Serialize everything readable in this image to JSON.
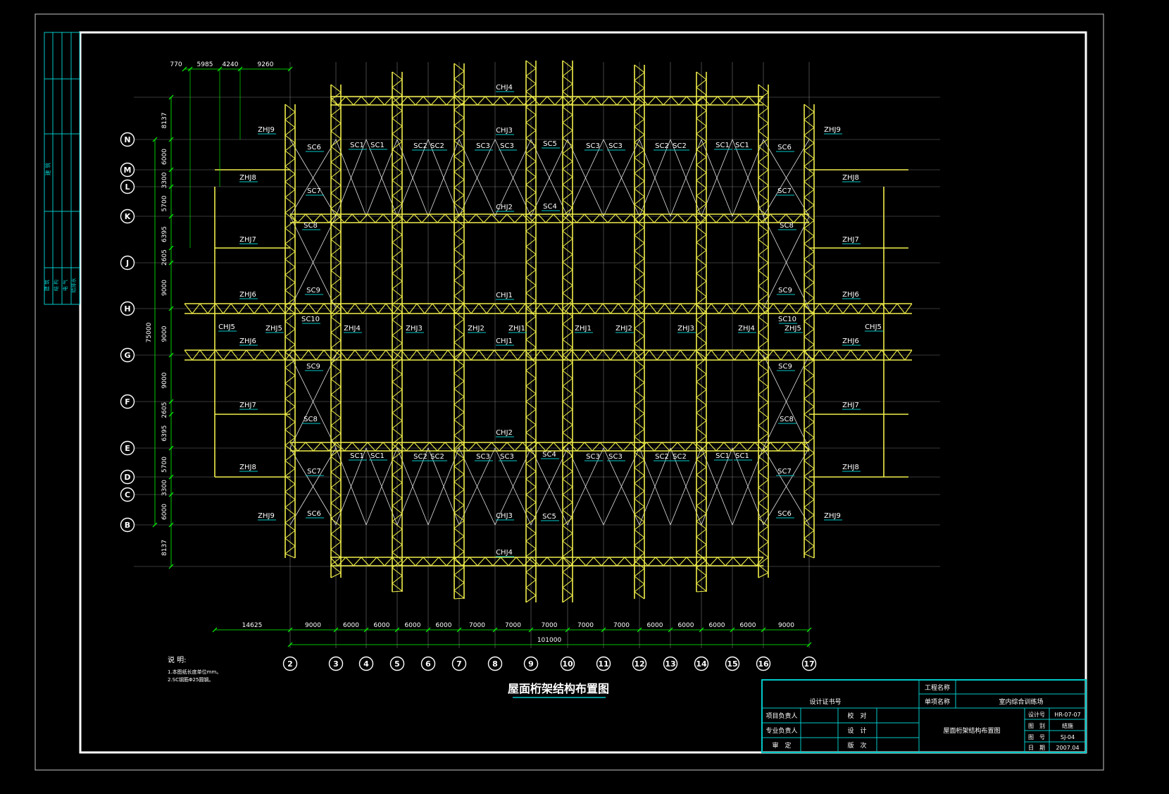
{
  "drawing": {
    "title": "屋面桁架结构布置图",
    "notes": {
      "heading": "说 明:",
      "lines": [
        "1.本图纸长度单位mm。",
        "2.SC钢筋Φ25圆钢。"
      ]
    },
    "colors": {
      "background": "#000000",
      "frame": "#ffffff",
      "truss": "#f0ee4a",
      "grid": "#cfcfcf",
      "dim": "#ffffff",
      "text": "#ffffff",
      "label_underline": "#00c8c8",
      "title_block": "#00c8c8"
    }
  },
  "axes": {
    "row_labels": [
      "N",
      "M",
      "L",
      "K",
      "J",
      "H",
      "G",
      "F",
      "E",
      "D",
      "C",
      "B"
    ],
    "col_labels": [
      "2",
      "3",
      "4",
      "5",
      "6",
      "7",
      "8",
      "9",
      "10",
      "11",
      "12",
      "13",
      "14",
      "15",
      "16",
      "17"
    ]
  },
  "dimensions": {
    "top": [
      "770",
      "5985",
      "4240",
      "9260"
    ],
    "left": [
      "8137",
      "6000",
      "3300",
      "5700",
      "6395",
      "2605",
      "9000",
      "9000",
      "9000",
      "2605",
      "6395",
      "5700",
      "3300",
      "6000",
      "8137"
    ],
    "left_total": "75000",
    "bottom_first": "14625",
    "bottom": [
      "9000",
      "6000",
      "6000",
      "6000",
      "6000",
      "7000",
      "7000",
      "7000",
      "7000",
      "7000",
      "6000",
      "6000",
      "6000",
      "6000",
      "9000"
    ],
    "bottom_total": "101000"
  },
  "labels": {
    "chj4": "CHJ4",
    "chj3": "CHJ3",
    "chj2": "CHJ2",
    "chj1": "CHJ1",
    "chj5": "CHJ5",
    "zhj9": "ZHJ9",
    "zhj8": "ZHJ8",
    "zhj7": "ZHJ7",
    "zhj6": "ZHJ6",
    "zhj5": "ZHJ5",
    "zhj4": "ZHJ4",
    "zhj3": "ZHJ3",
    "zhj2": "ZHJ2",
    "zhj1": "ZHJ1",
    "sc1": "SC1",
    "sc2": "SC2",
    "sc3": "SC3",
    "sc4": "SC4",
    "sc5": "SC5",
    "sc6": "SC6",
    "sc7": "SC7",
    "sc8": "SC8",
    "sc9": "SC9",
    "sc10": "SC10"
  },
  "title_block": {
    "cert": "设计证书号",
    "project_name_label": "工程名称",
    "project_name_value": "",
    "item_name_label": "单项名称",
    "item_name_value": "室内综合训练场",
    "roles": [
      "项目负责人",
      "专业负责人",
      "审　定"
    ],
    "checks": [
      "校　对",
      "设　计",
      "版　次"
    ],
    "drawing_name": "屋面桁架结构布置图",
    "meta_labels": [
      "设计号",
      "图　别",
      "图　号",
      "日　期"
    ],
    "meta_values": [
      "HR-07-07",
      "结施",
      "SJ-04",
      "2007.04"
    ]
  },
  "side_strip": {
    "top_text": "建 筑",
    "bottom_text": [
      "建 筑",
      "结 构",
      "电 气",
      "给排水"
    ]
  }
}
